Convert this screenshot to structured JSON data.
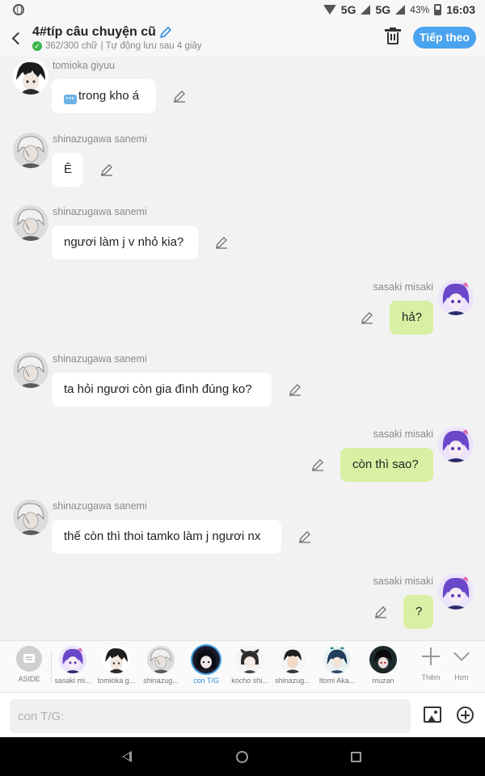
{
  "status_bar": {
    "network_1": "5G",
    "network_2": "5G",
    "battery_pct": "43%",
    "time": "16:03"
  },
  "header": {
    "title": "4#típ câu chuyện cũ",
    "word_count": "362/300 chữ",
    "autosave": "| Tự động lưu sau 4 giây",
    "next_label": "Tiếp theo"
  },
  "messages": [
    {
      "side": "left",
      "sender": "tomioka giyuu",
      "text": "trong kho á",
      "icon": "chat-dots-icon",
      "avatar": "giyuu"
    },
    {
      "side": "left",
      "sender": "shinazugawa sanemi",
      "text": "Ê",
      "avatar": "sanemi"
    },
    {
      "side": "left",
      "sender": "shinazugawa sanemi",
      "text": "ngươi làm j v nhỏ kia?",
      "avatar": "sanemi"
    },
    {
      "side": "right",
      "sender": "sasaki misaki",
      "text": "hả?",
      "avatar": "misaki"
    },
    {
      "side": "left",
      "sender": "shinazugawa sanemi",
      "text": "ta hỏi ngươi còn gia đình đúng ko?",
      "avatar": "sanemi"
    },
    {
      "side": "right",
      "sender": "sasaki misaki",
      "text": "còn thì sao?",
      "avatar": "misaki"
    },
    {
      "side": "left",
      "sender": "shinazugawa sanemi",
      "text": "thế còn thì thoi tamko làm j ngươi nx",
      "avatar": "sanemi"
    },
    {
      "side": "right",
      "sender": "sasaki misaki",
      "text": "?",
      "avatar": "misaki"
    }
  ],
  "characters": [
    {
      "name": "ASIDE"
    },
    {
      "name": "sasaki mi..."
    },
    {
      "name": "tomioka g..."
    },
    {
      "name": "shinazug..."
    },
    {
      "name": "con T/G",
      "selected": true
    },
    {
      "name": "kocho shi..."
    },
    {
      "name": "shinazug..."
    },
    {
      "name": "Itomi Aka..."
    },
    {
      "name": "muzan"
    }
  ],
  "char_actions": {
    "add_label": "Thêm",
    "more_label": "Hơn"
  },
  "input": {
    "placeholder": "con T/G:",
    "value": ""
  },
  "colors": {
    "accent": "#4aa3ef",
    "right_bubble": "#d8f0a3",
    "left_bubble": "#ffffff",
    "selected_name": "#2f8ee0"
  }
}
